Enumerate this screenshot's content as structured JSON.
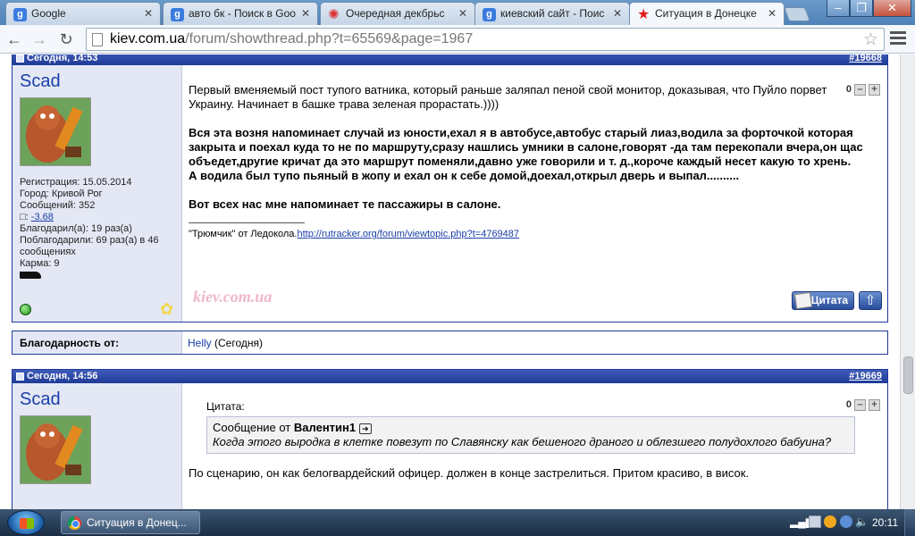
{
  "browser": {
    "tabs": [
      {
        "title": "Google",
        "icon": "google-icon",
        "active": false
      },
      {
        "title": "авто бк - Поиск в Goo",
        "icon": "google-icon",
        "active": false
      },
      {
        "title": "Очередная декбрьс",
        "icon": "flower-icon",
        "active": false
      },
      {
        "title": "киевский сайт - Поис",
        "icon": "google-icon",
        "active": false
      },
      {
        "title": "Ситуация в Донецке",
        "icon": "red-star-icon",
        "active": true
      }
    ],
    "url_host": "kiev.com.ua",
    "url_path": "/forum/showthread.php?t=65569&page=1967"
  },
  "posts": [
    {
      "date": "Сегодня, 14:53",
      "number": "#19668",
      "author": "Scad",
      "info": {
        "registration": "Регистрация: 15.05.2014",
        "city": "Город: Кривой Рог",
        "messages": "Сообщений: 352",
        "rep_label": "",
        "rep_value": "-3.68",
        "thanked": "Благодарил(а): 19 раз(а)",
        "thanked_by": "Поблагодарили: 69 раз(а) в 46 сообщениях",
        "karma": "Карма: 9"
      },
      "rating": "0",
      "text_intro": "Первый вменяемый пост тупого ватника, который раньше заляпал пеной свой монитор, доказывая, что Пуйло порвет Украину. Начинает в башке трава зеленая прорастать.))))",
      "text_bold_1": "Вся эта возня напоминает случай из юности,ехал я в автобусе,автобус старый лиаз,водила за форточкой которая закрыта и поехал куда то не по маршруту,сразу нашлись умники в салоне,говорят -да там перекопали вчера,он щас объедет,другие кричат да это маршрут поменяли,давно уже говорили и т. д.,короче каждый несет какую то хрень.",
      "text_bold_2": "А водила был тупо пьяный в жопу и ехал он к себе домой,доехал,открыл дверь и выпал..........",
      "text_bold_3": "Вот всех нас мне напоминает те пассажиры в салоне.",
      "signature_text": "\"Трюмчик\" от Ледокола.",
      "signature_link": "http://rutracker.org/forum/viewtopic.php?t=4769487",
      "watermark": "kiev.com.ua",
      "quote_button": "Цитата"
    },
    {
      "date": "Сегодня, 14:56",
      "number": "#19669",
      "author": "Scad",
      "rating": "0",
      "quote_title": "Цитата:",
      "quote_from_label": "Сообщение от",
      "quote_author": "Валентин1",
      "quote_text": "Когда этого выродка в клетке повезут по Славянску как бешеного драного и облезшего полудохлого бабуина?",
      "text": "По сценарию, он как белогвардейский офицер. должен в конце застрелиться. Притом красиво, в висок."
    }
  ],
  "thanks": {
    "label": "Благодарность от:",
    "user": "Helly",
    "when": "(Сегодня)"
  },
  "taskbar": {
    "window_title": "Ситуация в Донец...",
    "clock": "20:11"
  }
}
